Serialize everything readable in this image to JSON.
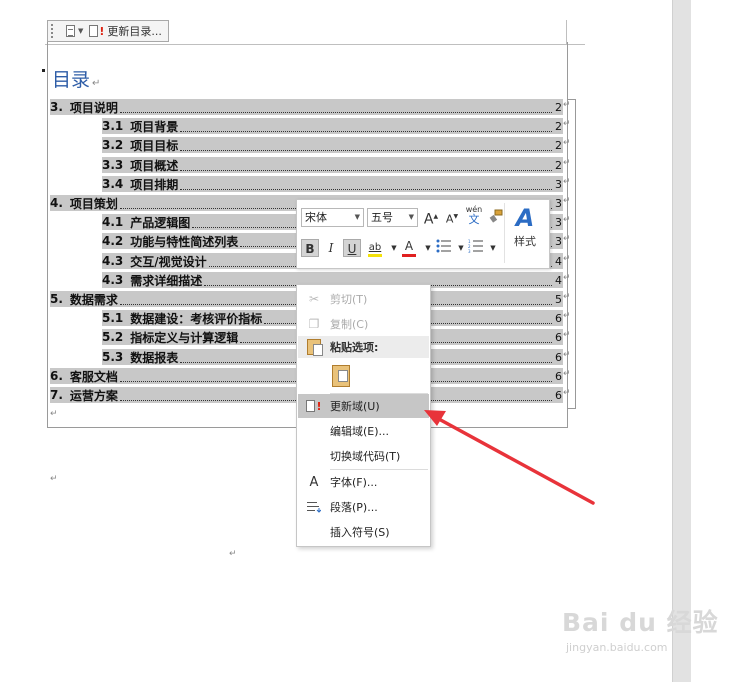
{
  "toc_toolbar": {
    "update_toc_label": "更新目录..."
  },
  "toc": {
    "title": "目录",
    "para_mark": "↵",
    "entries": [
      {
        "num": "3.",
        "text": "项目说明",
        "page": "2"
      },
      {
        "num": "3.1",
        "text": "项目背景",
        "page": "2"
      },
      {
        "num": "3.2",
        "text": "项目目标",
        "page": "2"
      },
      {
        "num": "3.3",
        "text": "项目概述",
        "page": "2"
      },
      {
        "num": "3.4",
        "text": "项目排期",
        "page": "3"
      },
      {
        "num": "4.",
        "text": "项目策划",
        "page": "3"
      },
      {
        "num": "4.1",
        "text": "产品逻辑图",
        "page": "3"
      },
      {
        "num": "4.2",
        "text": "功能与特性简述列表",
        "page": "3"
      },
      {
        "num": "4.3",
        "text": "交互/视觉设计",
        "page": "4"
      },
      {
        "num": "4.3",
        "text": "需求详细描述",
        "page": "4"
      },
      {
        "num": "5.",
        "text": "数据需求",
        "page": "5"
      },
      {
        "num": "5.1",
        "text": "数据建设：考核评价指标",
        "page": "6"
      },
      {
        "num": "5.2",
        "text": "指标定义与计算逻辑",
        "page": "6"
      },
      {
        "num": "5.3",
        "text": "数据报表",
        "page": "6"
      },
      {
        "num": "6.",
        "text": "客服文档",
        "page": "6"
      },
      {
        "num": "7.",
        "text": "运营方案",
        "page": "6"
      }
    ]
  },
  "mini_toolbar": {
    "font_name": "宋体",
    "font_size": "五号",
    "grow_font": "A",
    "shrink_font": "A",
    "phonetic": "wén",
    "phonetic_char": "文",
    "bold": "B",
    "italic": "I",
    "underline": "U",
    "highlight": "ab",
    "font_color": "A",
    "styles_label": "样式",
    "styles_glyph": "A"
  },
  "context_menu": {
    "cut": "剪切(T)",
    "copy": "复制(C)",
    "paste_options": "粘贴选项:",
    "update_field": "更新域(U)",
    "edit_field": "编辑域(E)...",
    "toggle_field_codes": "切换域代码(T)",
    "font": "字体(F)...",
    "paragraph": "段落(P)...",
    "insert_symbol": "插入符号(S)"
  },
  "watermark": {
    "brand": "Bai du 经验",
    "url": "jingyan.baidu.com"
  },
  "colors": {
    "toc_title": "#2e5da7",
    "field_shading": "#c8c8c8",
    "arrow": "#e8333a",
    "highlight_menu": "#c6c6c6"
  }
}
